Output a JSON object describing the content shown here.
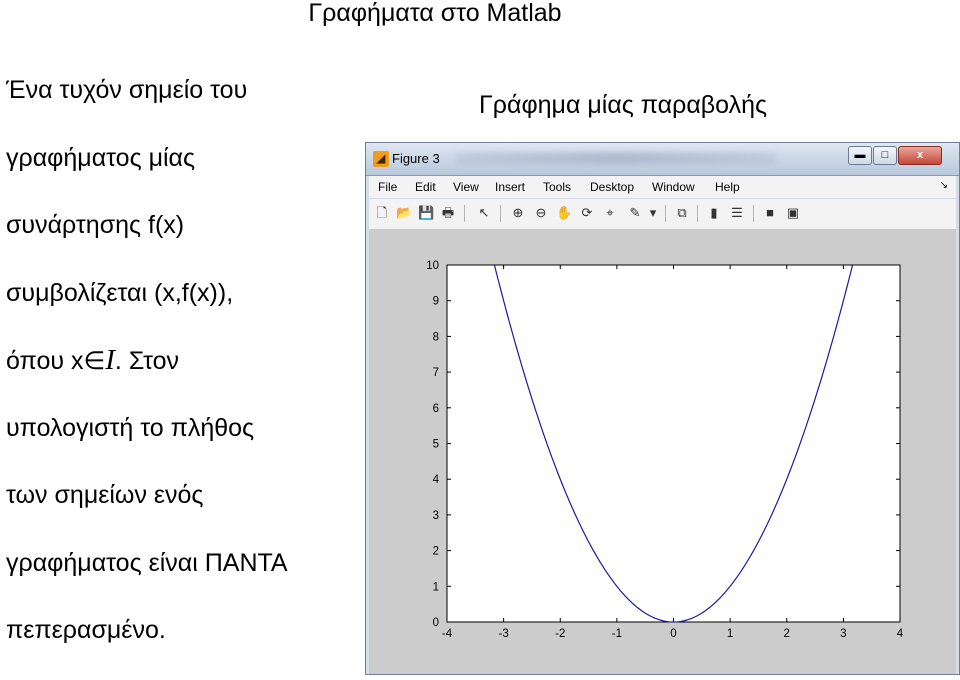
{
  "slide": {
    "title": "Γραφήματα στο Matlab",
    "caption": "Γράφημα μίας παραβολής",
    "text_lines": [
      "Ένα τυχόν σημείο του",
      "γραφήματος μίας",
      "συνάρτησης f(x)",
      "συμβολίζεται (x,f(x)),",
      "υπολογιστή το πλήθος",
      "των σημείων ενός",
      "γραφήματος είναι ΠΑΝΤΑ",
      "πεπερασμένο."
    ],
    "line5": {
      "prefix": "όπου x",
      "symbol": "∈",
      "set": "I",
      "suffix": ". Στον"
    }
  },
  "window": {
    "title": "Figure 3",
    "controls": {
      "minimize": "▬",
      "maximize": "□",
      "close": "x"
    },
    "menu": [
      "File",
      "Edit",
      "View",
      "Insert",
      "Tools",
      "Desktop",
      "Window",
      "Help"
    ],
    "menu_arrow": "↘",
    "toolbar": [
      {
        "name": "new-figure-icon",
        "glyph": "🗋"
      },
      {
        "name": "open-file-icon",
        "glyph": "📂"
      },
      {
        "name": "save-icon",
        "glyph": "💾"
      },
      {
        "name": "print-icon",
        "glyph": "🖶"
      },
      {
        "name": "edit-plot-icon",
        "glyph": "↖"
      },
      {
        "name": "zoom-in-icon",
        "glyph": "⊕"
      },
      {
        "name": "zoom-out-icon",
        "glyph": "⊖"
      },
      {
        "name": "pan-icon",
        "glyph": "✋"
      },
      {
        "name": "rotate-3d-icon",
        "glyph": "⟳"
      },
      {
        "name": "data-cursor-icon",
        "glyph": "⌖"
      },
      {
        "name": "brush-icon",
        "glyph": "✎"
      },
      {
        "name": "brush-dropdown-icon",
        "glyph": "▾"
      },
      {
        "name": "link-plot-icon",
        "glyph": "⧉"
      },
      {
        "name": "insert-colorbar-icon",
        "glyph": "▮"
      },
      {
        "name": "insert-legend-icon",
        "glyph": "☰"
      },
      {
        "name": "hide-plot-tools-icon",
        "glyph": "■"
      },
      {
        "name": "show-plot-tools-icon",
        "glyph": "▣"
      }
    ]
  },
  "colors": {
    "curve": "#1a1aa6",
    "canvas": "#cccccc"
  },
  "chart_data": {
    "type": "line",
    "function": "x^2",
    "series": [
      {
        "x": [
          -3.16,
          3.16
        ],
        "y_expr": "x^2"
      }
    ],
    "xlim": [
      -4,
      4
    ],
    "ylim": [
      0,
      10
    ],
    "xticks": [
      "-4",
      "-3",
      "-2",
      "-1",
      "0",
      "1",
      "2",
      "3",
      "4"
    ],
    "yticks": [
      "0",
      "1",
      "2",
      "3",
      "4",
      "5",
      "6",
      "7",
      "8",
      "9",
      "10"
    ],
    "grid": false
  }
}
